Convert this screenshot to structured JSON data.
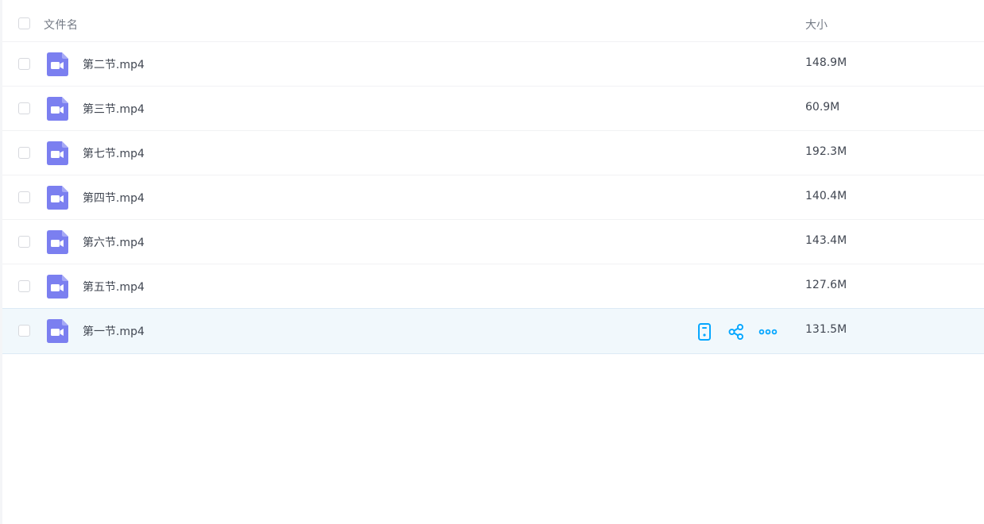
{
  "table": {
    "header": {
      "name_label": "文件名",
      "size_label": "大小"
    },
    "rows": [
      {
        "name": "第二节.mp4",
        "size": "148.9M"
      },
      {
        "name": "第三节.mp4",
        "size": "60.9M"
      },
      {
        "name": "第七节.mp4",
        "size": "192.3M"
      },
      {
        "name": "第四节.mp4",
        "size": "140.4M"
      },
      {
        "name": "第六节.mp4",
        "size": "143.4M"
      },
      {
        "name": "第五节.mp4",
        "size": "127.6M"
      },
      {
        "name": "第一节.mp4",
        "size": "131.5M"
      }
    ],
    "selected_row_index": 6
  },
  "icons": {
    "file_type": "video-file-icon",
    "row_actions": [
      "phone-icon",
      "share-icon",
      "more-icon"
    ]
  },
  "colors": {
    "video_icon": "#7b7ff0",
    "action_icon": "#06a7ff",
    "selected_row_bg": "#f1f8fc",
    "text": "#404651",
    "header_text": "#747a85"
  }
}
